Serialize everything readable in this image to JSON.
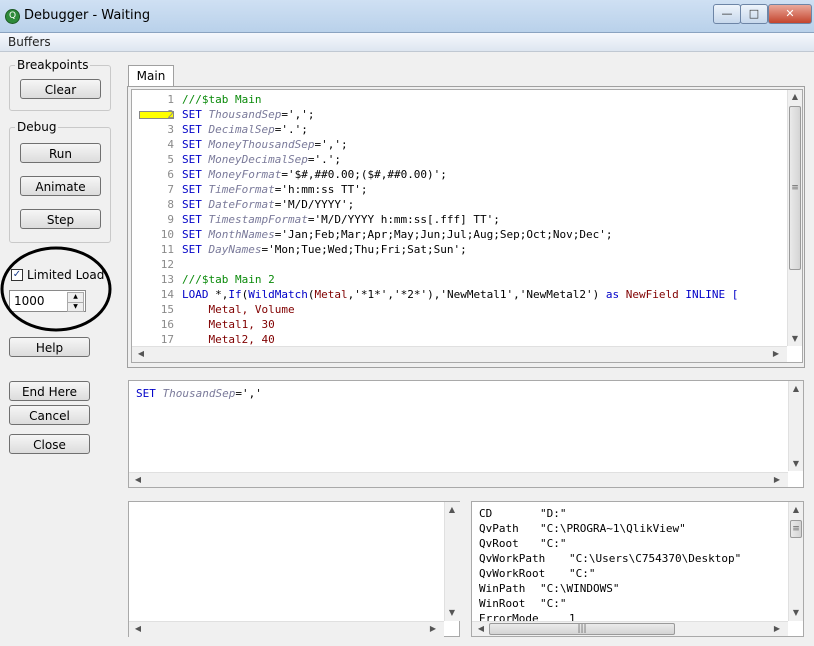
{
  "window": {
    "title": "Debugger - Waiting"
  },
  "menu": {
    "buffers": "Buffers"
  },
  "breakpoints": {
    "group_label": "Breakpoints",
    "clear_label": "Clear"
  },
  "debug": {
    "group_label": "Debug",
    "run_label": "Run",
    "animate_label": "Animate",
    "step_label": "Step"
  },
  "limited_load": {
    "label": "Limited Load",
    "checked": true,
    "value": "1000"
  },
  "buttons": {
    "help": "Help",
    "end_here": "End Here",
    "cancel": "Cancel",
    "close": "Close"
  },
  "tabs": [
    {
      "label": "Main"
    }
  ],
  "breakpoint_marker_color": "#ffff00",
  "code_lines": [
    {
      "n": "1",
      "parts": [
        [
          "cm",
          "///$tab Main"
        ]
      ]
    },
    {
      "n": "2",
      "parts": [
        [
          "kw",
          "SET "
        ],
        [
          "var",
          "ThousandSep"
        ],
        [
          "str",
          "=',';"
        ]
      ]
    },
    {
      "n": "3",
      "parts": [
        [
          "kw",
          "SET "
        ],
        [
          "var",
          "DecimalSep"
        ],
        [
          "str",
          "='.';"
        ]
      ]
    },
    {
      "n": "4",
      "parts": [
        [
          "kw",
          "SET "
        ],
        [
          "var",
          "MoneyThousandSep"
        ],
        [
          "str",
          "=',';"
        ]
      ]
    },
    {
      "n": "5",
      "parts": [
        [
          "kw",
          "SET "
        ],
        [
          "var",
          "MoneyDecimalSep"
        ],
        [
          "str",
          "='.';"
        ]
      ]
    },
    {
      "n": "6",
      "parts": [
        [
          "kw",
          "SET "
        ],
        [
          "var",
          "MoneyFormat"
        ],
        [
          "str",
          "='$#,##0.00;($#,##0.00)';"
        ]
      ]
    },
    {
      "n": "7",
      "parts": [
        [
          "kw",
          "SET "
        ],
        [
          "var",
          "TimeFormat"
        ],
        [
          "str",
          "='h:mm:ss TT';"
        ]
      ]
    },
    {
      "n": "8",
      "parts": [
        [
          "kw",
          "SET "
        ],
        [
          "var",
          "DateFormat"
        ],
        [
          "str",
          "='M/D/YYYY';"
        ]
      ]
    },
    {
      "n": "9",
      "parts": [
        [
          "kw",
          "SET "
        ],
        [
          "var",
          "TimestampFormat"
        ],
        [
          "str",
          "='M/D/YYYY h:mm:ss[.fff] TT';"
        ]
      ]
    },
    {
      "n": "10",
      "parts": [
        [
          "kw",
          "SET "
        ],
        [
          "var",
          "MonthNames"
        ],
        [
          "str",
          "='Jan;Feb;Mar;Apr;May;Jun;Jul;Aug;Sep;Oct;Nov;Dec';"
        ]
      ]
    },
    {
      "n": "11",
      "parts": [
        [
          "kw",
          "SET "
        ],
        [
          "var",
          "DayNames"
        ],
        [
          "str",
          "='Mon;Tue;Wed;Thu;Fri;Sat;Sun';"
        ]
      ]
    },
    {
      "n": "12",
      "parts": []
    },
    {
      "n": "13",
      "parts": [
        [
          "cm",
          "///$tab Main 2"
        ]
      ]
    },
    {
      "n": "14",
      "parts": [
        [
          "kw",
          "LOAD "
        ],
        [
          "str",
          "*,"
        ],
        [
          "fn",
          "If"
        ],
        [
          "str",
          "("
        ],
        [
          "fn",
          "WildMatch"
        ],
        [
          "str",
          "("
        ],
        [
          "fld",
          "Metal"
        ],
        [
          "str",
          ",'*1*','*2*'),'NewMetal1','NewMetal2') "
        ],
        [
          "kw",
          "as "
        ],
        [
          "fld",
          "NewField "
        ],
        [
          "kw",
          "INLINE ["
        ]
      ]
    },
    {
      "n": "15",
      "parts": [
        [
          "fld",
          "    Metal, Volume"
        ]
      ]
    },
    {
      "n": "16",
      "parts": [
        [
          "fld",
          "    Metal1, 30"
        ]
      ]
    },
    {
      "n": "17",
      "parts": [
        [
          "fld",
          "    Metal2, 40"
        ]
      ]
    }
  ],
  "current_statement": {
    "kw": "SET ",
    "var": "ThousandSep",
    "rest": "=','"
  },
  "variables": [
    {
      "name": "CD",
      "value": "\"D:\""
    },
    {
      "name": "QvPath",
      "value": "\"C:\\PROGRA~1\\QlikView\""
    },
    {
      "name": "QvRoot",
      "value": "\"C:\""
    },
    {
      "name": "QvWorkPath",
      "value": "\"C:\\Users\\C754370\\Desktop\""
    },
    {
      "name": "QvWorkRoot",
      "value": "\"C:\""
    },
    {
      "name": "WinPath",
      "value": "\"C:\\WINDOWS\""
    },
    {
      "name": "WinRoot",
      "value": "\"C:\""
    },
    {
      "name": "ErrorMode",
      "value": "1"
    }
  ],
  "annotation": {
    "shape": "ellipse",
    "color": "#000000"
  },
  "icons": {
    "app": "qlikview-icon",
    "minimize": "minimize-icon",
    "maximize": "maximize-icon",
    "close": "close-icon"
  }
}
